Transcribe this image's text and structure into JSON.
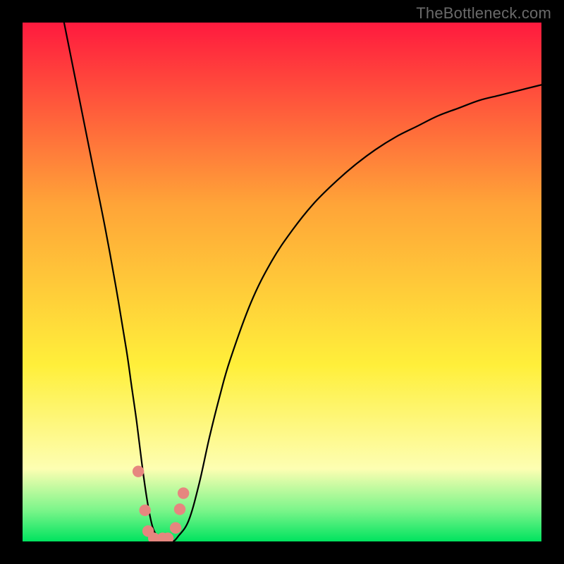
{
  "watermark": "TheBottleneck.com",
  "colors": {
    "red": "#ff1a3e",
    "orange": "#ffa438",
    "yellow": "#ffef3a",
    "pale_yellow": "#fdfeb2",
    "green_light": "#7bf58a",
    "green": "#00e35f",
    "black": "#000000",
    "dot": "#e6867f",
    "curve": "#000000"
  },
  "chart_data": {
    "type": "line",
    "title": "",
    "xlabel": "",
    "ylabel": "",
    "xlim": [
      0,
      100
    ],
    "ylim": [
      0,
      100
    ],
    "curve": {
      "x": [
        8,
        10,
        12,
        14,
        16,
        18,
        20,
        21,
        22,
        23,
        24,
        25,
        26,
        27,
        28,
        29,
        30,
        32,
        34,
        36,
        38,
        40,
        44,
        48,
        52,
        56,
        60,
        64,
        68,
        72,
        76,
        80,
        84,
        88,
        92,
        96,
        100
      ],
      "y": [
        100,
        90,
        80,
        70,
        60,
        49,
        37,
        30,
        23,
        15,
        8,
        3,
        1,
        0,
        0,
        0,
        1,
        4,
        11,
        20,
        28,
        35,
        46,
        54,
        60,
        65,
        69,
        72.5,
        75.5,
        78,
        80,
        82,
        83.5,
        85,
        86,
        87,
        88
      ]
    },
    "markers": [
      {
        "x": 22.3,
        "y": 13.5
      },
      {
        "x": 23.6,
        "y": 6.0
      },
      {
        "x": 24.2,
        "y": 2.0
      },
      {
        "x": 25.3,
        "y": 0.6
      },
      {
        "x": 27.0,
        "y": 0.6
      },
      {
        "x": 28.0,
        "y": 0.6
      },
      {
        "x": 29.5,
        "y": 2.6
      },
      {
        "x": 30.3,
        "y": 6.2
      },
      {
        "x": 31.0,
        "y": 9.3
      }
    ],
    "gradient_stops_pct": {
      "red": 0,
      "orange": 35,
      "yellow": 66,
      "pale_yellow": 86,
      "green_light": 94,
      "green": 100
    }
  }
}
